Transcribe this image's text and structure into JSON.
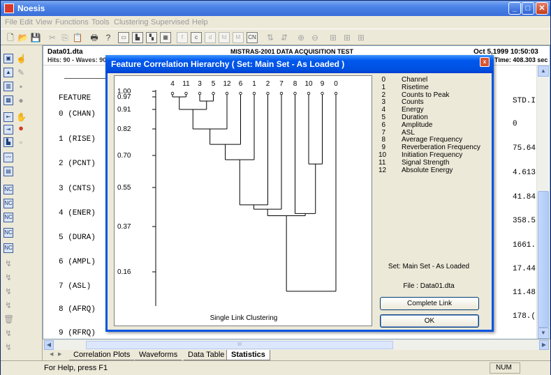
{
  "app": {
    "title": "Noesis"
  },
  "menu": [
    "File",
    "Edit",
    "View",
    "Functions",
    "Tools",
    "Clustering",
    "Supervised",
    "Help"
  ],
  "toolbar_icons": [
    "new-file",
    "open-folder",
    "save",
    "cut",
    "copy",
    "paste",
    "print",
    "help",
    "view-1",
    "view-2",
    "view-3",
    "view-4",
    "view-5",
    "view-6",
    "view-7",
    "view-8",
    "view-9",
    "view-10",
    "view-11",
    "zoom-in",
    "zoom-out",
    "view-12",
    "view-13",
    "view-14"
  ],
  "document": {
    "file": "Data01.dta",
    "hits": "Hits: 90 - Waves: 90",
    "center_title": "MISTRAS-2001 DATA ACQUISITION TEST",
    "date": "Oct 5,1999 10:50:03",
    "time": "Time: 408.303 sec",
    "feature_header": "FEATURE",
    "std_header": "STD.I",
    "features": [
      "0 (CHAN)",
      "1 (RISE)",
      "2 (PCNT)",
      "3 (CNTS)",
      "4 (ENER)",
      "5 (DURA)",
      "6 (AMPL)",
      "7 (ASL)",
      "8 (AFRQ)",
      "9 (RFRQ)"
    ],
    "std_values": [
      "0",
      "75.64",
      "4.613",
      "41.84",
      "358.5",
      "1661.",
      "17.44",
      "11.48",
      "178.("
    ]
  },
  "tabs": [
    "Correlation Plots",
    "Waveforms",
    "Data Table",
    "Statistics"
  ],
  "active_tab": "Statistics",
  "status": {
    "help": "For Help, press F1",
    "num": "NUM"
  },
  "dialog": {
    "title": "Feature Correlation Hierarchy ( Set: Main Set - As Loaded )",
    "close_label": "x",
    "legend": [
      {
        "num": "0",
        "name": "Channel"
      },
      {
        "num": "1",
        "name": "Risetime"
      },
      {
        "num": "2",
        "name": "Counts to Peak"
      },
      {
        "num": "3",
        "name": "Counts"
      },
      {
        "num": "4",
        "name": "Energy"
      },
      {
        "num": "5",
        "name": "Duration"
      },
      {
        "num": "6",
        "name": "Amplitude"
      },
      {
        "num": "7",
        "name": "ASL"
      },
      {
        "num": "8",
        "name": "Average Frequency"
      },
      {
        "num": "9",
        "name": "Reverberation Frequency"
      },
      {
        "num": "10",
        "name": "Initiation Frequency"
      },
      {
        "num": "11",
        "name": "Signal Strength"
      },
      {
        "num": "12",
        "name": "Absolute Energy"
      }
    ],
    "set_info": "Set: Main Set - As Loaded",
    "file_info": "File : Data01.dta",
    "complete_link_button": "Complete Link",
    "ok_button": "OK",
    "caption": "Single Link Clustering"
  },
  "chart_data": {
    "type": "dendrogram",
    "leaf_order": [
      "4",
      "11",
      "3",
      "5",
      "12",
      "6",
      "1",
      "2",
      "7",
      "8",
      "10",
      "9",
      "0"
    ],
    "y_ticks": [
      1.0,
      0.97,
      0.91,
      0.82,
      0.7,
      0.55,
      0.37,
      0.16
    ],
    "y_tick_labels": [
      "1.00",
      "0.97",
      "0.91",
      "0.82",
      "0.70",
      "0.55",
      "0.37",
      "0.16"
    ],
    "merges": [
      {
        "a": "4",
        "b": "11",
        "level": 0.97
      },
      {
        "a": "3",
        "b": "5",
        "level": 0.95
      },
      {
        "a": "4,11",
        "b": "3,5",
        "level": 0.91
      },
      {
        "a": "4,11,3,5",
        "b": "12",
        "level": 0.82
      },
      {
        "a": "4,11,3,5,12",
        "b": "6",
        "level": 0.75
      },
      {
        "a": "4,11,3,5,12,6",
        "b": "1",
        "level": 0.68
      },
      {
        "a": "10",
        "b": "9",
        "level": 0.66
      },
      {
        "a": "4,11,3,5,12,6,1",
        "b": "2",
        "level": 0.47
      },
      {
        "a": "4,11,3,5,12,6,1,2",
        "b": "7",
        "level": 0.45
      },
      {
        "a": "8",
        "b": "10,9",
        "level": 0.43
      },
      {
        "a": "4,11,3,5,12,6,1,2,7",
        "b": "8,10,9",
        "level": 0.42
      },
      {
        "a": "4,11,3,5,12,6,1,2,7,8,10,9",
        "b": "0",
        "level": 0.07
      }
    ]
  }
}
